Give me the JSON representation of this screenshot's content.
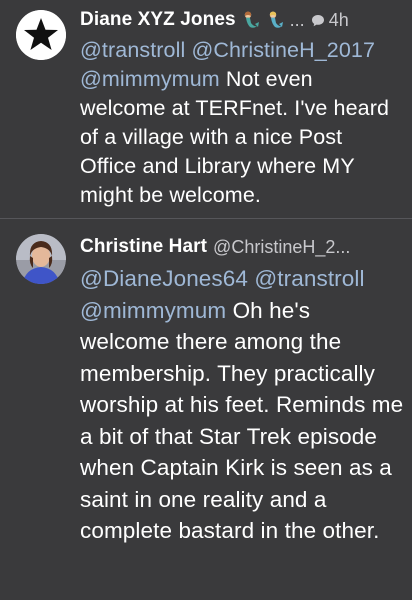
{
  "tweets": [
    {
      "author_name": "Diane XYZ Jones",
      "ellipsis": "...",
      "time": "4h",
      "mentions": [
        "@transtroll",
        "@ChristineH_2017",
        "@mimmymum"
      ],
      "text": "Not even welcome at TERFnet. I've heard of a village with a nice Post Office and Library where MY might be welcome."
    },
    {
      "author_name": "Christine Hart",
      "handle": "@ChristineH_2...",
      "mentions": [
        "@DianeJones64",
        "@transtroll",
        "@mimmymum"
      ],
      "text": "Oh he's welcome there among the membership. They practically worship at his feet. Reminds me a bit of that Star Trek episode when Captain Kirk is seen as a saint in one reality and a complete bastard in the other."
    }
  ],
  "colors": {
    "background": "#3a3a3c",
    "mention": "#9fb8d6",
    "meta": "#c8c8cc"
  },
  "icons": [
    "star-avatar-icon",
    "mermaid-emoji-icon",
    "reply-bubble-icon"
  ]
}
